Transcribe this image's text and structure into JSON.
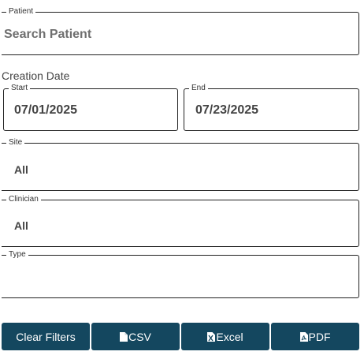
{
  "patient": {
    "legend": "Patient",
    "placeholder": "Search Patient"
  },
  "creation_date": {
    "label": "Creation Date",
    "start": {
      "legend": "Start",
      "value": "07/01/2025"
    },
    "end": {
      "legend": "End",
      "value": "07/23/2025"
    }
  },
  "site": {
    "legend": "Site",
    "value": "All"
  },
  "clinician": {
    "legend": "Clinician",
    "value": "All"
  },
  "type": {
    "legend": "Type",
    "value": ""
  },
  "buttons": {
    "clear_filters": "Clear Filters",
    "csv": "CSV",
    "excel": "Excel",
    "pdf": "PDF"
  },
  "icons": {
    "csv": "file-icon",
    "excel": "excel-file-icon",
    "pdf": "pdf-file-icon"
  },
  "colors": {
    "button_bg": "#14475f",
    "button_text": "#ffffff",
    "border": "#222222"
  }
}
